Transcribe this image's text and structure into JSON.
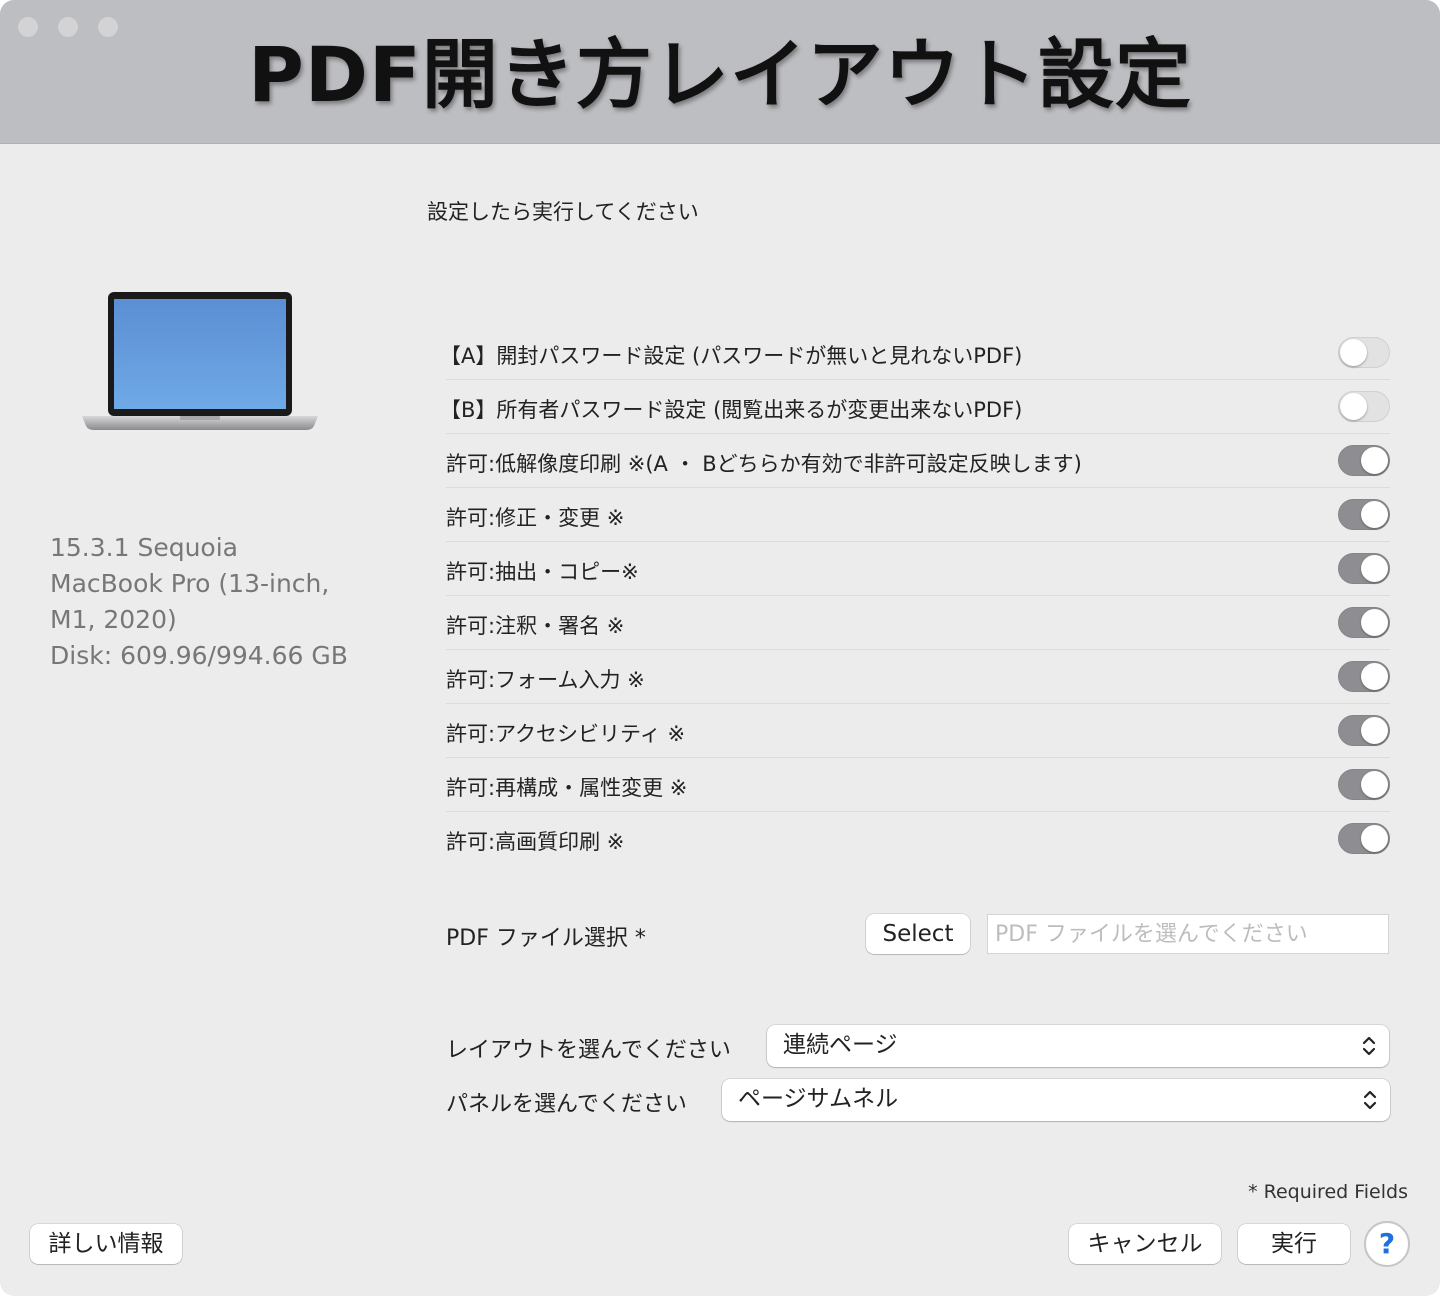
{
  "window": {
    "title": "PDF開き方レイアウト設定"
  },
  "instruction": "設定したら実行してください",
  "system_info": {
    "line1": "15.3.1 Sequoia",
    "line2": "MacBook Pro (13-inch,",
    "line3": "M1, 2020)",
    "line4": "Disk: 609.96/994.66 GB"
  },
  "settings": [
    {
      "label": "【A】開封パスワード設定 (パスワードが無いと見れないPDF)",
      "on": false
    },
    {
      "label": "【B】所有者パスワード設定 (閲覧出来るが変更出来ないPDF)",
      "on": false
    },
    {
      "label": "許可:低解像度印刷 ※(A ・ Bどちらか有効で非許可設定反映します)",
      "on": true
    },
    {
      "label": "許可:修正・変更 ※",
      "on": true
    },
    {
      "label": "許可:抽出・コピー※",
      "on": true
    },
    {
      "label": "許可:注釈・署名 ※",
      "on": true
    },
    {
      "label": "許可:フォーム入力 ※",
      "on": true
    },
    {
      "label": "許可:アクセシビリティ ※",
      "on": true
    },
    {
      "label": "許可:再構成・属性変更 ※",
      "on": true
    },
    {
      "label": "許可:高画質印刷 ※",
      "on": true
    }
  ],
  "file_select": {
    "label": "PDF ファイル選択 *",
    "button": "Select",
    "placeholder": "PDF ファイルを選んでください",
    "value": ""
  },
  "layout_select": {
    "label": "レイアウトを選んでください",
    "value": "連続ページ"
  },
  "panel_select": {
    "label": "パネルを選んでください",
    "value": "ページサムネル"
  },
  "footer": {
    "required_note": "* Required Fields",
    "details_button": "詳しい情報",
    "cancel_button": "キャンセル",
    "run_button": "実行",
    "help_button": "?"
  },
  "colors": {
    "titlebar": "#bdbec2",
    "background": "#ececec",
    "toggle_on": "#8e8e92",
    "toggle_off": "#e2e2e2",
    "help_accent": "#1f6fe0"
  }
}
